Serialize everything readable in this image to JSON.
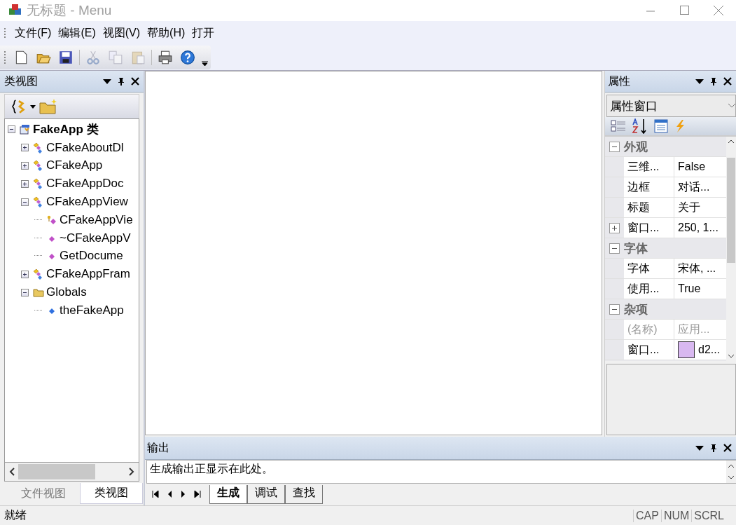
{
  "window": {
    "title": "无标题 - Menu"
  },
  "menu": [
    "文件(F)",
    "编辑(E)",
    "视图(V)",
    "帮助(H)",
    "打开"
  ],
  "toolbar": [
    {
      "kind": "new",
      "disabled": false
    },
    {
      "kind": "open",
      "disabled": false
    },
    {
      "kind": "save",
      "disabled": false
    },
    {
      "kind": "cut",
      "disabled": true
    },
    {
      "kind": "copy",
      "disabled": true
    },
    {
      "kind": "paste",
      "disabled": true
    },
    {
      "kind": "print",
      "disabled": false
    },
    {
      "kind": "help",
      "disabled": false
    }
  ],
  "class_view": {
    "title": "类视图",
    "tree": [
      {
        "label": "FakeApp 类",
        "kind": "project",
        "expanded": true,
        "children": [
          {
            "label": "CFakeAboutDl",
            "kind": "class",
            "expanded": false
          },
          {
            "label": "CFakeApp",
            "kind": "class",
            "expanded": false
          },
          {
            "label": "CFakeAppDoc",
            "kind": "class",
            "expanded": false
          },
          {
            "label": "CFakeAppView",
            "kind": "class",
            "expanded": true,
            "children": [
              {
                "label": "CFakeAppVie",
                "kind": "protected-method"
              },
              {
                "label": "~CFakeAppV",
                "kind": "method"
              },
              {
                "label": "GetDocume",
                "kind": "method"
              }
            ]
          },
          {
            "label": "CFakeAppFram",
            "kind": "class",
            "expanded": false
          },
          {
            "label": "Globals",
            "kind": "folder",
            "expanded": true,
            "children": [
              {
                "label": "theFakeApp",
                "kind": "variable"
              }
            ]
          }
        ]
      }
    ],
    "tabs": [
      {
        "label": "文件视图",
        "selected": false
      },
      {
        "label": "类视图",
        "selected": true
      }
    ]
  },
  "properties": {
    "title": "属性",
    "object": "属性窗口",
    "categories": [
      {
        "name": "外观",
        "expanded": true,
        "rows": [
          {
            "name": "三维...",
            "value": "False"
          },
          {
            "name": "边框",
            "value": "对话..."
          },
          {
            "name": "标题",
            "value": "关于"
          },
          {
            "name": "窗口...",
            "value": "250, 1...",
            "expanded": false
          }
        ]
      },
      {
        "name": "字体",
        "expanded": true,
        "rows": [
          {
            "name": "字体",
            "value": "宋体, ..."
          },
          {
            "name": "使用...",
            "value": "True"
          }
        ]
      },
      {
        "name": "杂项",
        "expanded": true,
        "rows": [
          {
            "name": "(名称)",
            "value": "应用...",
            "disabled": true
          },
          {
            "name": "窗口...",
            "value": "d2...",
            "color": "#d8b8f0"
          }
        ]
      }
    ]
  },
  "output": {
    "title": "输出",
    "lines": [
      "生成输出正显示在此处。"
    ],
    "tabs": [
      {
        "label": "生成",
        "selected": true
      },
      {
        "label": "调试",
        "selected": false
      },
      {
        "label": "查找",
        "selected": false
      }
    ]
  },
  "status_bar": {
    "text": "就绪",
    "indicators": [
      "CAP",
      "NUM",
      "SCRL"
    ]
  }
}
